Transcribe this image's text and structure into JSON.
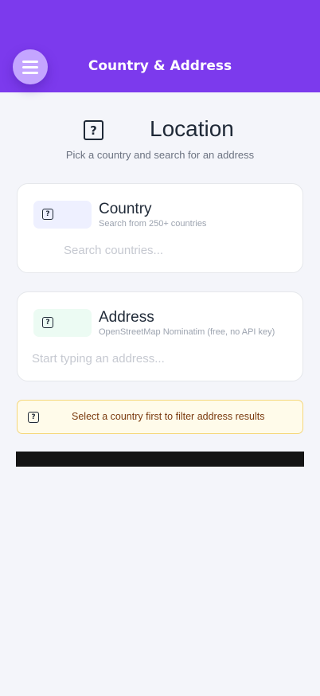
{
  "header": {
    "title": "Country & Address",
    "menu_icon": "hamburger-menu-icon",
    "accent_color": "#7c3aed"
  },
  "location": {
    "title": "Location",
    "subtitle": "Pick a country and search for an address",
    "icon": "question-box-icon"
  },
  "country_card": {
    "title": "Country",
    "subtitle": "Search from 250+ countries",
    "placeholder": "Search countries...",
    "icon": "question-box-icon"
  },
  "address_card": {
    "title": "Address",
    "subtitle": "OpenStreetMap Nominatim (free, no API key)",
    "placeholder": "Start typing an address...",
    "icon": "question-box-icon"
  },
  "notice": {
    "text": "Select a country first to filter address results",
    "icon": "question-box-icon",
    "color": "#fffbea"
  }
}
